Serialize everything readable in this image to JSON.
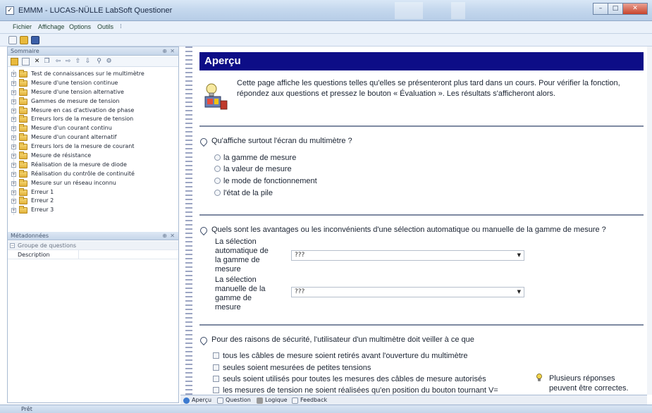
{
  "window": {
    "title": "EMMM - LUCAS-NÜLLE LabSoft Questioner"
  },
  "menu": {
    "items": [
      "Fichier",
      "Affichage",
      "Options",
      "Outils"
    ]
  },
  "summary_pane": {
    "title": "Sommaire",
    "items": [
      "Test de connaissances sur le multimètre",
      "Mesure d'une tension continue",
      "Mesure d'une tension alternative",
      "Gammes de mesure de tension",
      "Mesure en cas d'activation de phase",
      "Erreurs lors de la mesure de tension",
      "Mesure d'un courant continu",
      "Mesure d'un courant alternatif",
      "Erreurs lors de la mesure de courant",
      "Mesure de résistance",
      "Réalisation de la mesure de diode",
      "Réalisation du contrôle de continuité",
      "Mesure sur un réseau inconnu",
      "Erreur 1",
      "Erreur 2",
      "Erreur 3"
    ]
  },
  "metadata_pane": {
    "title": "Métadonnées",
    "group": "Groupe de questions",
    "property": "Description"
  },
  "preview": {
    "heading": "Aperçu",
    "intro": "Cette page affiche les questions telles qu'elles se présenteront plus tard dans un cours. Pour vérifier la fonction, répondez aux questions et pressez le bouton « Évaluation ». Les résultats s'afficheront alors.",
    "q1": {
      "text": "Qu'affiche surtout l'écran du multimètre ?",
      "options": [
        "la gamme de mesure",
        "la valeur de mesure",
        "le mode de fonctionnement",
        "l'état de la pile"
      ]
    },
    "q2": {
      "text": "Quels sont les avantages ou les inconvénients d'une sélection automatique ou manuelle de la gamme de mesure ?",
      "rows": [
        {
          "label": "La sélection automatique de la gamme de mesure",
          "value": "???"
        },
        {
          "label": "La sélection manuelle de la gamme de mesure",
          "value": "???"
        }
      ]
    },
    "q3": {
      "text": "Pour des raisons de sécurité, l'utilisateur d'un multimètre doit veiller à ce que",
      "options": [
        "tous les câbles de mesure soient retirés avant l'ouverture du multimètre",
        "seules soient mesurées de petites tensions",
        "seuls soient utilisés pour toutes les mesures des câbles de mesure autorisés",
        "les mesures de tension ne soient réalisées qu'en position du bouton tournant V="
      ],
      "hint": "Plusieurs réponses peuvent être correctes."
    }
  },
  "tabs": [
    "Aperçu",
    "Question",
    "Logique",
    "Feedback"
  ],
  "status": {
    "text": "Prêt"
  },
  "colors": {
    "heading_bg": "#0d0d87",
    "accent": "#3a5f9a"
  }
}
